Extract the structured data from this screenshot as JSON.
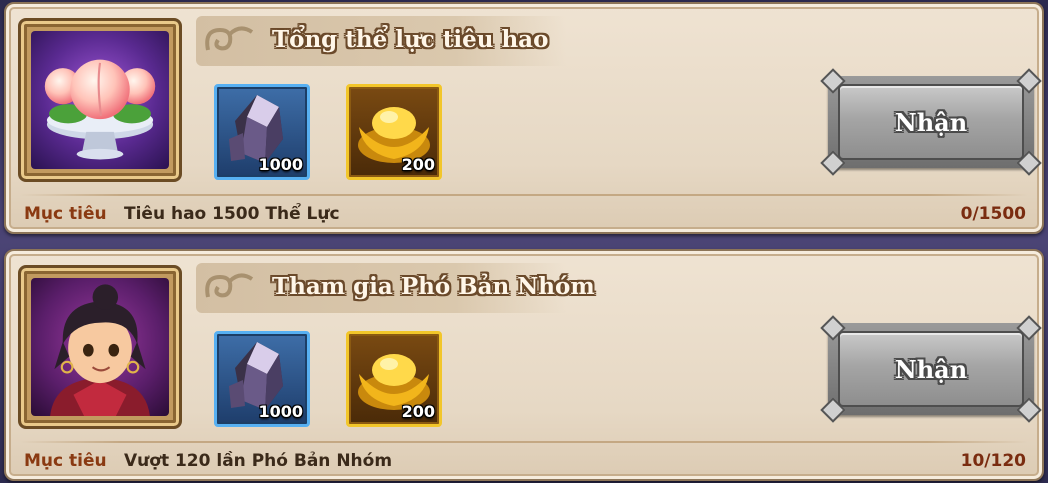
{
  "tasks": [
    {
      "title": "Tổng thể lực tiêu hao",
      "portrait_icon": "peach-on-plate-icon",
      "rewards": [
        {
          "icon": "dark-crystal-icon",
          "quantity": "1000",
          "frame": "blue"
        },
        {
          "icon": "gold-ingot-icon",
          "quantity": "200",
          "frame": "gold"
        }
      ],
      "claim_label": "Nhận",
      "goal_label": "Mục tiêu",
      "goal_text": "Tiêu hao 1500 Thể Lực",
      "progress": "0/1500"
    },
    {
      "title": "Tham gia Phó Bản Nhóm",
      "portrait_icon": "hero-portrait-icon",
      "rewards": [
        {
          "icon": "dark-crystal-icon",
          "quantity": "1000",
          "frame": "blue"
        },
        {
          "icon": "gold-ingot-icon",
          "quantity": "200",
          "frame": "gold"
        }
      ],
      "claim_label": "Nhận",
      "goal_label": "Mục tiêu",
      "goal_text": "Vượt 120 lần Phó Bản Nhóm",
      "progress": "10/120"
    }
  ],
  "colors": {
    "card_bg": "#e6d8c4",
    "goal_label": "#8a3a12",
    "goal_text": "#3b2a1a",
    "reward_blue_frame": "#57b0f2",
    "reward_gold_frame": "#f2c62a",
    "button_gray": "#a5a5a5"
  }
}
